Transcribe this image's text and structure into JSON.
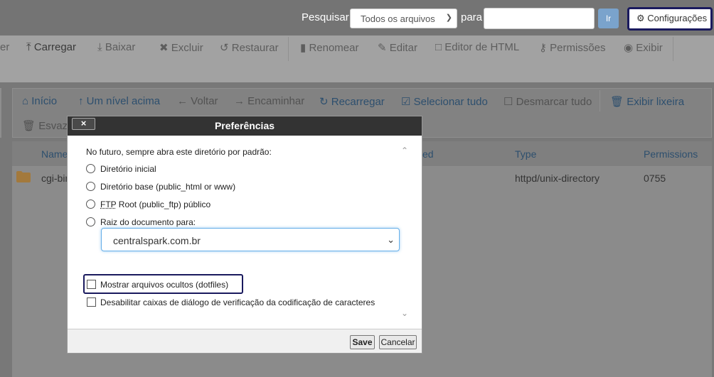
{
  "header": {
    "search_label": "Pesquisar",
    "search_scope": "Todos os arquivos",
    "for_label": "para",
    "search_value": "",
    "go_label": "Ir",
    "settings_label": "Configurações",
    "settings_icon": "gear-icon"
  },
  "toolbar": {
    "partial_left": "er",
    "upload": "Carregar",
    "download": "Baixar",
    "delete": "Excluir",
    "restore": "Restaurar",
    "rename": "Renomear",
    "edit": "Editar",
    "html_editor": "Editor de HTML",
    "permissions": "Permissões",
    "view": "Exibir"
  },
  "nav": {
    "home": "Início",
    "up_level": "Um nível acima",
    "back": "Voltar",
    "forward": "Encaminhar",
    "reload": "Recarregar",
    "select_all": "Selecionar tudo",
    "unselect_all": "Desmarcar tudo",
    "view_trash": "Exibir lixeira",
    "empty_trash_partial": "Esvazia"
  },
  "file_table": {
    "columns": {
      "name": "Name",
      "modified_partial": "ed",
      "type": "Type",
      "permissions": "Permissions"
    },
    "rows": [
      {
        "name_partial": "cgi-bin",
        "type": "httpd/unix-directory",
        "permissions": "0755"
      }
    ]
  },
  "dialog": {
    "title": "Preferências",
    "close_label": "×",
    "prompt": "No futuro, sempre abra este diretório por padrão:",
    "options": [
      {
        "label": "Diretório inicial",
        "checked": false
      },
      {
        "label": "Diretório base (public_html or www)",
        "checked": false
      },
      {
        "label_abbr": "FTP",
        "label_rest": " Root (public_ftp) público",
        "checked": false
      },
      {
        "label": "Raiz do documento para:",
        "checked": false
      }
    ],
    "docroot_value": "centralspark.com.br",
    "checkboxes": [
      {
        "label": "Mostrar arquivos ocultos (dotfiles)",
        "checked": false
      },
      {
        "label": "Desabilitar caixas de diálogo de verificação da codificação de caracteres",
        "checked": false
      }
    ],
    "save_label": "Save",
    "cancel_label": "Cancelar"
  },
  "colors": {
    "accent_link": "#2d4f6e",
    "focus_ring": "#1a1a5e",
    "dialog_title_bg": "#333333",
    "folder": "#e8a84a"
  }
}
